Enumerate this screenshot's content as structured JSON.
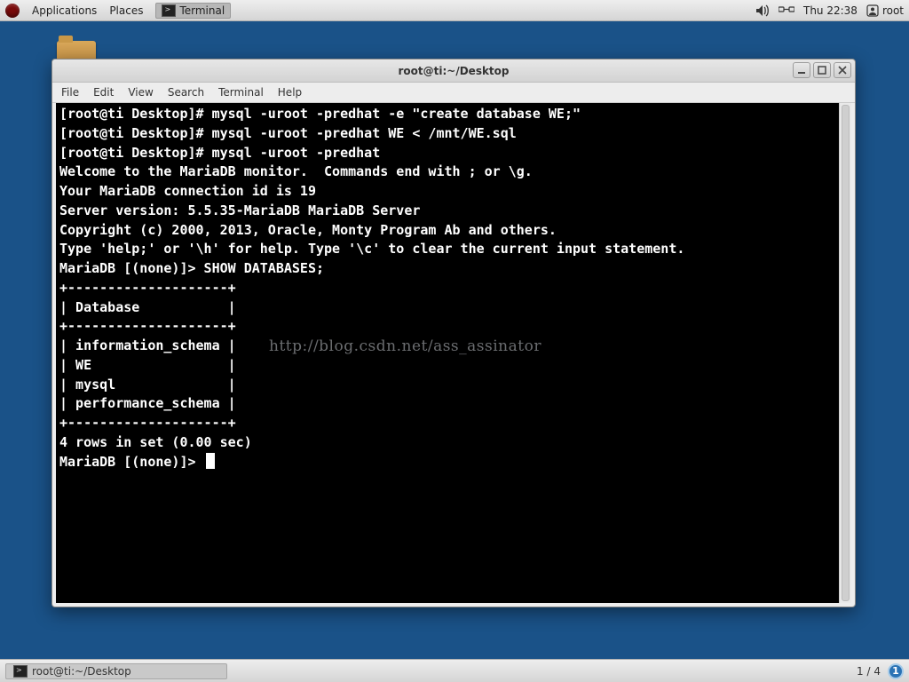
{
  "panel": {
    "applications": "Applications",
    "places": "Places",
    "task_terminal": "Terminal",
    "clock": "Thu 22:38",
    "user": "root"
  },
  "window": {
    "title": "root@ti:~/Desktop",
    "menus": [
      "File",
      "Edit",
      "View",
      "Search",
      "Terminal",
      "Help"
    ]
  },
  "terminal": {
    "lines": [
      "[root@ti Desktop]# mysql -uroot -predhat -e \"create database WE;\"",
      "[root@ti Desktop]# mysql -uroot -predhat WE < /mnt/WE.sql",
      "[root@ti Desktop]# mysql -uroot -predhat",
      "Welcome to the MariaDB monitor.  Commands end with ; or \\g.",
      "Your MariaDB connection id is 19",
      "Server version: 5.5.35-MariaDB MariaDB Server",
      "",
      "Copyright (c) 2000, 2013, Oracle, Monty Program Ab and others.",
      "",
      "Type 'help;' or '\\h' for help. Type '\\c' to clear the current input statement.",
      "",
      "MariaDB [(none)]> SHOW DATABASES;",
      "+--------------------+",
      "| Database           |",
      "+--------------------+",
      "| information_schema |",
      "| WE                 |",
      "| mysql              |",
      "| performance_schema |",
      "+--------------------+",
      "4 rows in set (0.00 sec)",
      "",
      "MariaDB [(none)]> "
    ],
    "watermark": "http://blog.csdn.net/ass_assinator"
  },
  "bottombar": {
    "task": "root@ti:~/Desktop",
    "workspaces": "1 / 4",
    "active_ws": "1"
  }
}
